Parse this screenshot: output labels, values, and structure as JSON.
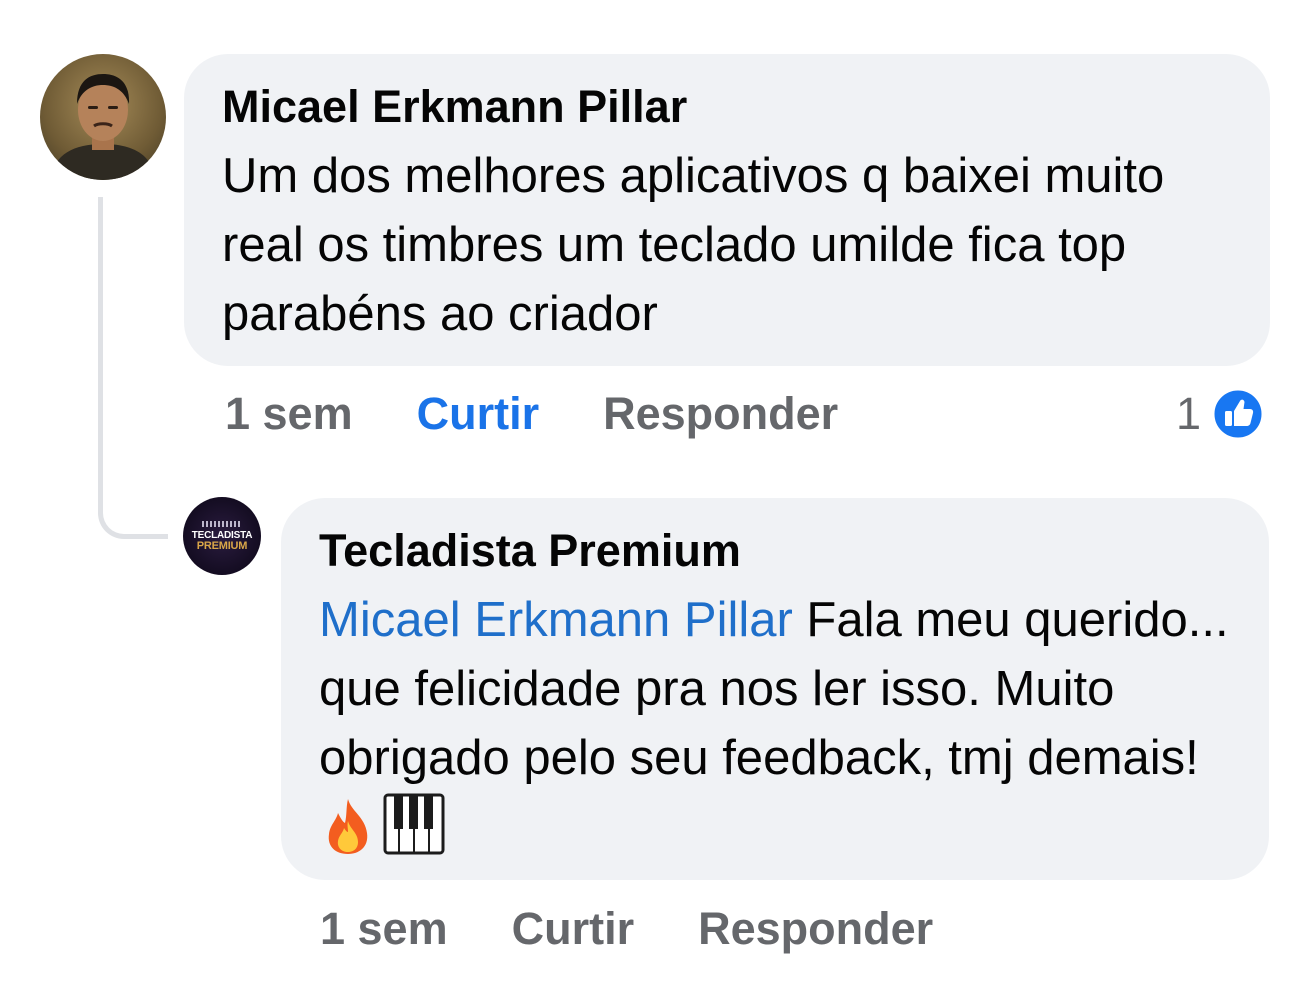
{
  "comment": {
    "author": "Micael Erkmann Pillar",
    "text": "Um dos melhores aplicativos q baixei muito real os timbres um teclado umilde fica top parabéns ao criador",
    "time": "1 sem",
    "like_label": "Curtir",
    "reply_label": "Responder",
    "liked": true,
    "reaction_count": "1",
    "reaction_icon": "thumbs-up-icon",
    "avatar_icon": "user-photo-avatar"
  },
  "reply": {
    "author": "Tecladista Premium",
    "mention": "Micael Erkmann Pillar",
    "text": " Fala meu querido... que felicidade pra nos ler isso. Muito obrigado pelo seu feedback, tmj demais!",
    "emojis": [
      "fire-icon",
      "piano-icon"
    ],
    "time": "1 sem",
    "like_label": "Curtir",
    "reply_label": "Responder",
    "avatar_logo": {
      "line1": "TECLADISTA",
      "line2": "PREMIUM"
    }
  },
  "colors": {
    "bubble_bg": "#f0f2f5",
    "mention": "#1f6fca",
    "liked": "#1a73e8",
    "muted": "#65676b",
    "reaction_bg": "#1877f2",
    "logo_gold": "#d9a648"
  }
}
